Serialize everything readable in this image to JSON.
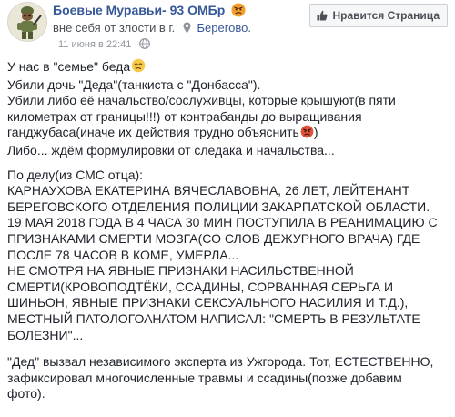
{
  "header": {
    "page_name": "Боевые Муравьи- 93 ОМБр",
    "feeling_text": "вне себя от злости в г.",
    "location": "Берегово.",
    "timestamp": "11 июня в 22:41",
    "like_page_label": "Нравится Страница",
    "icons": {
      "feeling": "angry-face-icon",
      "location": "map-pin-icon",
      "audience": "globe-icon",
      "like": "thumbs-up-icon"
    }
  },
  "post": {
    "p1": [
      "У нас в \"семье\" беда",
      "Убили дочь \"Деда\"(танкиста с \"Донбасса\").",
      "Убили либо её начальство/сослуживцы, которые крышуют(в пяти",
      "километрах от границы!!!) от контрабанды до выращивания",
      "ганджубаса(иначе их действия трудно объяснить",
      "Либо... ждём формулировки от следака и начальства..."
    ],
    "p1_close": ")",
    "p2": [
      "По делу(из СМС отца):",
      "КАРНАУХОВА ЕКАТЕРИНА ВЯЧЕСЛАВОВНА, 26 ЛЕТ, ЛЕЙТЕНАНТ",
      "БЕРЕГОВСКОГО ОТДЕЛЕНИЯ ПОЛИЦИИ ЗАКАРПАТСКОЙ ОБЛАСТИ.",
      "19 МАЯ 2018 ГОДА В 4 ЧАСА 30 МИН ПОСТУПИЛА В РЕАНИМАЦИЮ С",
      "ПРИЗНАКАМИ СМЕРТИ МОЗГА(СО СЛОВ ДЕЖУРНОГО ВРАЧА) ГДЕ",
      "ПОСЛЕ 78 ЧАСОВ В КОМЕ, УМЕРЛА...",
      "НЕ СМОТРЯ НА ЯВНЫЕ ПРИЗНАКИ НАСИЛЬСТВЕННОЙ",
      "СМЕРТИ(КРОВОПОДТЁКИ, ССАДИНЫ, СОРВАННАЯ СЕРЬГА И",
      "ШИНЬОН, ЯВНЫЕ ПРИЗНАКИ СЕКСУАЛЬНОГО НАСИЛИЯ И Т.Д.),",
      "МЕСТНЫЙ ПАТОЛОГОАНАТОМ НАПИСАЛ: \"СМЕРТЬ В РЕЗУЛЬТАТЕ",
      "БОЛЕЗНИ\"..."
    ],
    "p3": [
      "\"Дед\" вызвал независимого эксперта из Ужгорода. Тот, ЕСТЕСТВЕННО,",
      "зафиксировал многочисленные травмы и ссадины(позже добавим",
      "фото)."
    ],
    "emoji": {
      "crying": "crying-face-icon",
      "angry": "angry-face-icon"
    }
  }
}
